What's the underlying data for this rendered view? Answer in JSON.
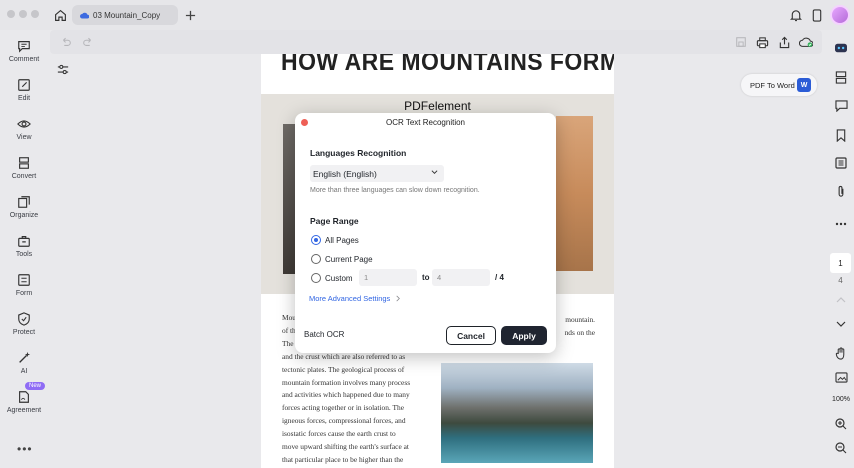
{
  "titlebar": {
    "tab_name": "03 Mountain_Copy"
  },
  "sidebar": {
    "items": [
      {
        "label": "Comment",
        "icon": "comment-icon"
      },
      {
        "label": "Edit",
        "icon": "edit-icon"
      },
      {
        "label": "View",
        "icon": "eye-icon"
      },
      {
        "label": "Convert",
        "icon": "convert-icon"
      },
      {
        "label": "Organize",
        "icon": "organize-icon"
      },
      {
        "label": "Tools",
        "icon": "toolbox-icon"
      },
      {
        "label": "Form",
        "icon": "form-icon"
      },
      {
        "label": "Protect",
        "icon": "shield-icon"
      },
      {
        "label": "AI",
        "icon": "ai-wand-icon"
      },
      {
        "label": "Agreement",
        "icon": "agreement-icon",
        "badge": "New"
      }
    ],
    "more": "•••"
  },
  "document": {
    "heading": "HOW ARE MOUNTAINS FORMED?",
    "image_caption": "PDFelement",
    "left_lines": [
      "Mou",
      "of th",
      "The",
      "and the crust which are also referred to as",
      "tectonic plates. The geological process of",
      "mountain formation involves many process",
      "and activities which happened due to many",
      "forces acting together or in isolation. The",
      "igneous forces, compressional forces, and",
      "isostatic forces cause the earth crust to",
      "move upward shifting the earth's surface at",
      "that particular place to be higher than the"
    ],
    "right_lines": [
      "mountain.",
      "nds on the"
    ]
  },
  "right_panel": {
    "pdf_to_word": "PDF To Word",
    "word_badge": "W",
    "current_page": "1",
    "total_pages": "4",
    "zoom": "100%"
  },
  "ocr_dialog": {
    "title": "OCR Text Recognition",
    "languages_title": "Languages Recognition",
    "language_value": "English (English)",
    "language_hint": "More than three languages can slow down recognition.",
    "page_range_title": "Page Range",
    "options": {
      "all_pages": "All Pages",
      "current_page": "Current Page",
      "custom": "Custom"
    },
    "selected_option": "All Pages",
    "custom_from_placeholder": "1",
    "custom_to_label": "to",
    "custom_to_placeholder": "4",
    "custom_total": "/ 4",
    "advanced_link": "More Advanced Settings",
    "batch_label": "Batch OCR",
    "cancel_label": "Cancel",
    "apply_label": "Apply"
  },
  "colors": {
    "accent_blue": "#3266e3",
    "apply_button": "#1f2430",
    "close_dot": "#ee5f56",
    "new_badge": "#8f6cf5"
  }
}
